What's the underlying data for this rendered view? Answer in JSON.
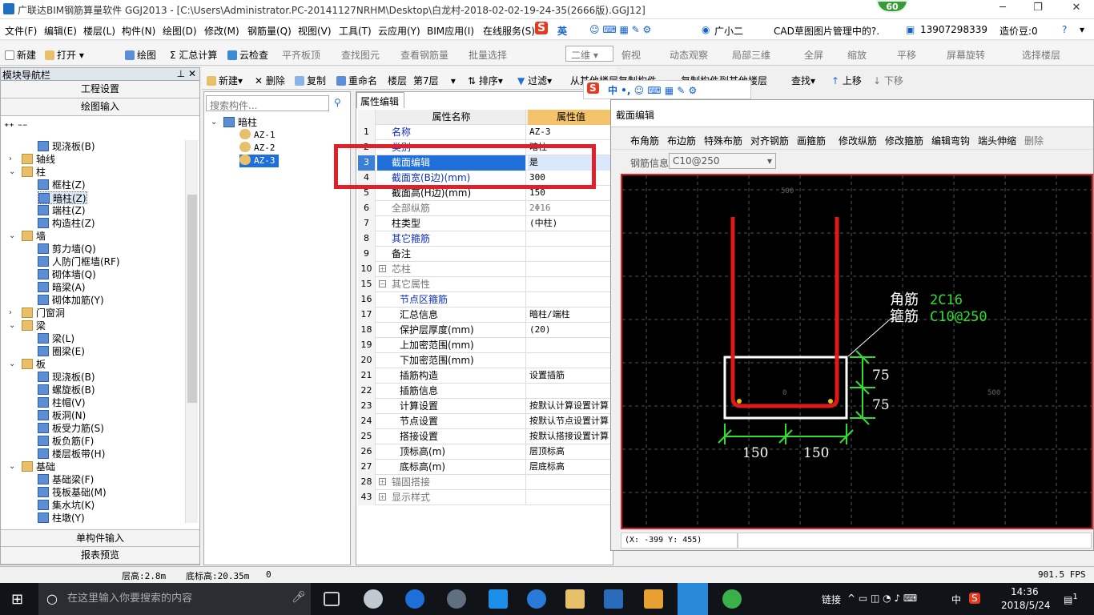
{
  "window": {
    "title": "广联达BIM钢筋算量软件 GGJ2013 - [C:\\Users\\Administrator.PC-20141127NRHM\\Desktop\\白龙村-2018-02-02-19-24-35(2666版).GGJ12]",
    "badge": "60"
  },
  "menu": [
    "文件(F)",
    "编辑(E)",
    "楼层(L)",
    "构件(N)",
    "绘图(D)",
    "修改(M)",
    "钢筋量(Q)",
    "视图(V)",
    "工具(T)",
    "云应用(Y)",
    "BIM应用(I)",
    "在线服务(S)"
  ],
  "menu_right": {
    "ime": "英",
    "user": "广小二",
    "cad": "CAD草图图片管理中的?.",
    "phone": "13907298339",
    "zaojiadou": "造价豆:0"
  },
  "toolbar": [
    "新建",
    "打开",
    "绘图",
    "Σ 汇总计算",
    "云检查",
    "平齐板顶",
    "查找图元",
    "查看钢筋量",
    "批量选择",
    "二维",
    "俯视",
    "动态观察",
    "局部三维",
    "全屏",
    "缩放",
    "平移",
    "屏幕旋转",
    "选择楼层"
  ],
  "left": {
    "title": "模块导航栏",
    "btn1": "工程设置",
    "btn2": "绘图输入",
    "btn3": "单构件输入",
    "btn4": "报表预览",
    "tree": [
      "现浇板(B)",
      "轴线",
      "柱",
      "框柱(Z)",
      "暗柱(Z)",
      "端柱(Z)",
      "构造柱(Z)",
      "墙",
      "剪力墙(Q)",
      "人防门框墙(RF)",
      "砌体墙(Q)",
      "暗梁(A)",
      "砌体加筋(Y)",
      "门窗洞",
      "梁",
      "梁(L)",
      "圈梁(E)",
      "板",
      "现浇板(B)",
      "螺旋板(B)",
      "柱帽(V)",
      "板洞(N)",
      "板受力筋(S)",
      "板负筋(F)",
      "楼层板带(H)",
      "基础",
      "基础梁(F)",
      "筏板基础(M)",
      "集水坑(K)",
      "柱墩(Y)"
    ]
  },
  "subtoolbar": {
    "new": "新建",
    "delete": "删除",
    "copy": "复制",
    "rename": "重命名",
    "floor_label": "楼层",
    "floor": "第7层",
    "sort": "排序",
    "filter": "过滤",
    "copy_from": "从其他楼层复制构件",
    "copy_to": "复制构件到其他楼层",
    "find": "查找",
    "up": "上移",
    "down": "下移"
  },
  "mid": {
    "search_placeholder": "搜索构件...",
    "root": "暗柱",
    "items": [
      "AZ-1",
      "AZ-2",
      "AZ-3"
    ]
  },
  "props": {
    "tab": "属性编辑",
    "col_name": "属性名称",
    "col_value": "属性值",
    "rows": [
      {
        "n": "1",
        "k": "名称",
        "v": "AZ-3"
      },
      {
        "n": "2",
        "k": "类别",
        "v": "暗柱"
      },
      {
        "n": "3",
        "k": "截面编辑",
        "v": "是"
      },
      {
        "n": "4",
        "k": "截面宽(B边)(mm)",
        "v": "300"
      },
      {
        "n": "5",
        "k": "截面高(H边)(mm)",
        "v": "150"
      },
      {
        "n": "6",
        "k": "全部纵筋",
        "v": "2Φ16"
      },
      {
        "n": "7",
        "k": "柱类型",
        "v": "(中柱)"
      },
      {
        "n": "8",
        "k": "其它箍筋",
        "v": ""
      },
      {
        "n": "9",
        "k": "备注",
        "v": ""
      },
      {
        "n": "10",
        "k": "芯柱",
        "v": ""
      },
      {
        "n": "15",
        "k": "其它属性",
        "v": ""
      },
      {
        "n": "16",
        "k": "节点区箍筋",
        "v": ""
      },
      {
        "n": "17",
        "k": "汇总信息",
        "v": "暗柱/端柱"
      },
      {
        "n": "18",
        "k": "保护层厚度(mm)",
        "v": "(20)"
      },
      {
        "n": "19",
        "k": "上加密范围(mm)",
        "v": ""
      },
      {
        "n": "20",
        "k": "下加密范围(mm)",
        "v": ""
      },
      {
        "n": "21",
        "k": "插筋构造",
        "v": "设置插筋"
      },
      {
        "n": "22",
        "k": "插筋信息",
        "v": ""
      },
      {
        "n": "23",
        "k": "计算设置",
        "v": "按默认计算设置计算"
      },
      {
        "n": "24",
        "k": "节点设置",
        "v": "按默认节点设置计算"
      },
      {
        "n": "25",
        "k": "搭接设置",
        "v": "按默认搭接设置计算"
      },
      {
        "n": "26",
        "k": "顶标高(m)",
        "v": "层顶标高"
      },
      {
        "n": "27",
        "k": "底标高(m)",
        "v": "层底标高"
      },
      {
        "n": "28",
        "k": "锚固搭接",
        "v": ""
      },
      {
        "n": "43",
        "k": "显示样式",
        "v": ""
      }
    ]
  },
  "section": {
    "title": "截面编辑",
    "tools": [
      "布角筋",
      "布边筋",
      "特殊布筋",
      "对齐钢筋",
      "画箍筋",
      "修改纵筋",
      "修改箍筋",
      "编辑弯钩",
      "端头伸缩",
      "删除"
    ],
    "rebar_label": "钢筋信息",
    "rebar_value": "C10@250",
    "corner_label": "角筋",
    "corner_value": "2C16",
    "stirrup_label": "箍筋",
    "stirrup_value": "C10@250",
    "dim_75a": "75",
    "dim_75b": "75",
    "dim_150a": "150",
    "dim_150b": "150",
    "axis_500": "500",
    "axis_0": "0",
    "coords": "(X: -399 Y: 455)"
  },
  "status": {
    "floor_height": "层高:2.8m",
    "base_height": "底标高:20.35m",
    "zero": "0",
    "fps": "901.5 FPS"
  },
  "taskbar": {
    "search": "在这里输入你要搜索的内容",
    "link": "链接",
    "lang": "中",
    "time": "14:36",
    "date": "2018/5/24",
    "notif": "1"
  }
}
